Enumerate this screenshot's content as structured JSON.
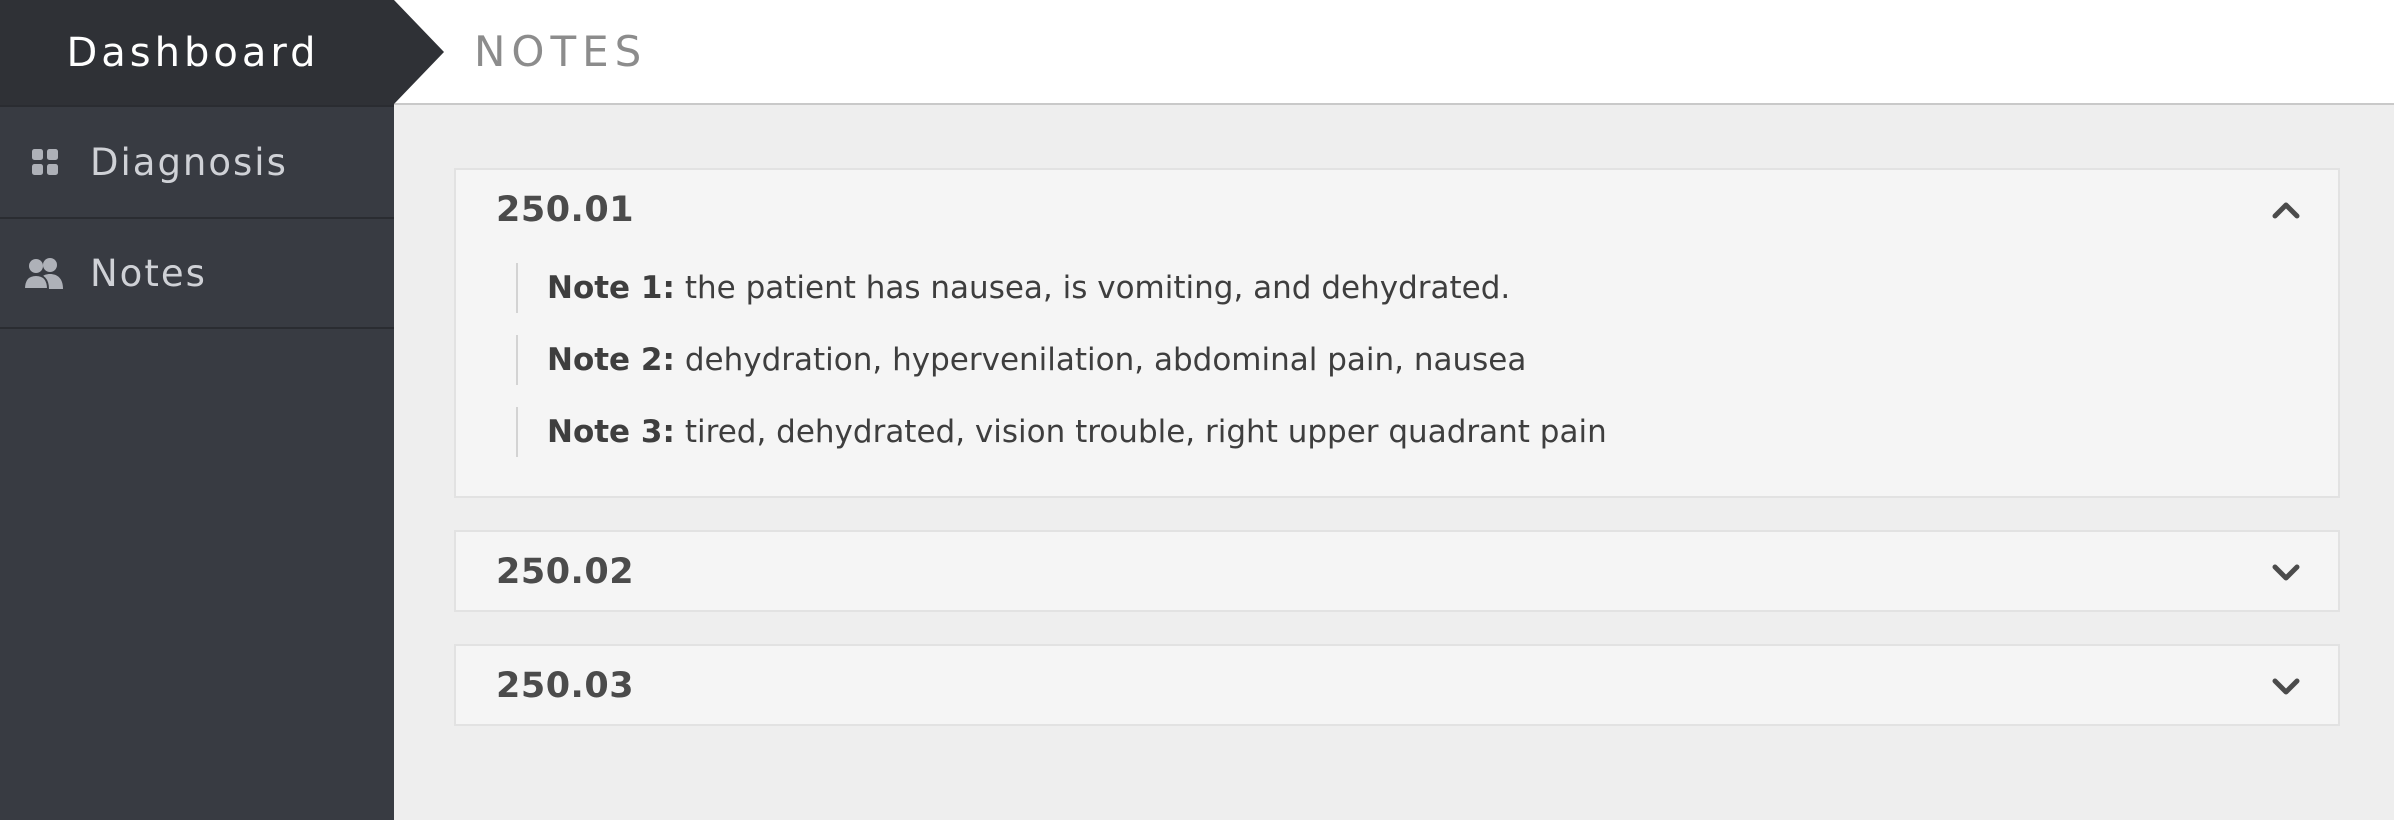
{
  "sidebar": {
    "brand": "Dashboard",
    "items": [
      {
        "label": "Diagnosis",
        "icon": "grid-icon"
      },
      {
        "label": "Notes",
        "icon": "users-icon"
      }
    ]
  },
  "header": {
    "title": "NOTES"
  },
  "accordion": [
    {
      "code": "250.01",
      "expanded": true,
      "notes": [
        {
          "label": "Note 1:",
          "text": "the patient has nausea, is vomiting, and dehydrated."
        },
        {
          "label": "Note 2:",
          "text": "dehydration, hypervenilation, abdominal pain, nausea"
        },
        {
          "label": "Note 3:",
          "text": "tired, dehydrated, vision trouble, right upper quadrant pain"
        }
      ]
    },
    {
      "code": "250.02",
      "expanded": false
    },
    {
      "code": "250.03",
      "expanded": false
    }
  ],
  "colors": {
    "sidebar": "#383b42",
    "brand_bg": "#2f3136",
    "content_bg": "#eeeeee",
    "panel_bg": "#f5f5f5"
  }
}
